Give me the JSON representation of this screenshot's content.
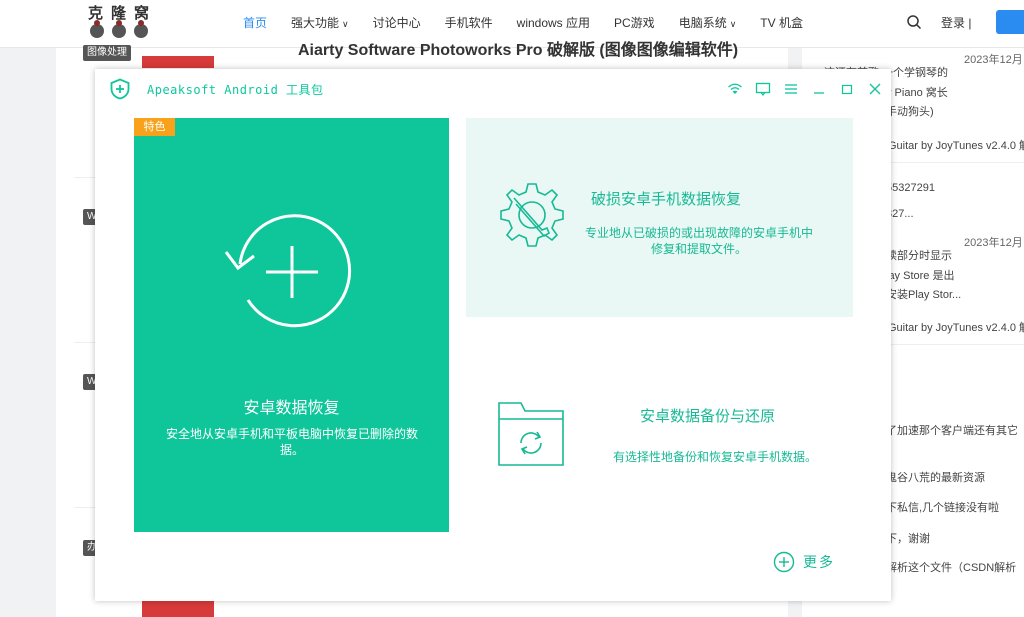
{
  "site": {
    "logo_text": "克隆窝",
    "nav": [
      {
        "label": "首页",
        "active": true,
        "dropdown": false
      },
      {
        "label": "强大功能",
        "active": false,
        "dropdown": true
      },
      {
        "label": "讨论中心",
        "active": false,
        "dropdown": false
      },
      {
        "label": "手机软件",
        "active": false,
        "dropdown": false
      },
      {
        "label": "windows 应用",
        "active": false,
        "dropdown": false
      },
      {
        "label": "PC游戏",
        "active": false,
        "dropdown": false
      },
      {
        "label": "电脑系统",
        "active": false,
        "dropdown": true
      },
      {
        "label": "TV 机盒",
        "active": false,
        "dropdown": false
      }
    ],
    "nav_dropdown_glyph": "∨",
    "login_label": "登录 |",
    "article_tag_1": "图像处理",
    "article_title_1": "Aiarty Software Photoworks Pro 破解版 (图像图像编辑软件)",
    "article_tag_2": "W",
    "article_tag_3": "W",
    "article_tag_4": "办",
    "sidebar": {
      "date_1": "2023年12月",
      "text_1": "这还有首歌 一个学钢琴的",
      "text_2": "y Piano 窝长",
      "text_3": "手动狗头)",
      "text_4": "Guitar by JoyTunes v2.4.0 解",
      "text_5": "55327291",
      "text_6": "327...",
      "date_2": "2023年12月",
      "text_7": "读部分时显示",
      "text_8": "lay Store 是出",
      "text_9": "安装Play Stor...",
      "text_10": "Guitar by JoyTunes v2.4.0 解",
      "text_11": "了加速那个客户端还有其它",
      "text_12": "鬼谷八荒的最新资源",
      "text_13": "下私信,几个链接没有啦",
      "text_14": "下，谢谢",
      "text_15": "解析这个文件（CSDN解析"
    }
  },
  "app": {
    "title": "Apeaksoft Android 工具包",
    "accent_color": "#0fc69b",
    "badge_color": "#f7a21a",
    "titlebar_icons": [
      "wifi-icon",
      "feedback-icon",
      "menu-icon",
      "minimize-icon",
      "maximize-icon",
      "close-icon"
    ],
    "panels": {
      "data_recovery": {
        "badge": "特色",
        "title": "安卓数据恢复",
        "desc": "安全地从安卓手机和平板电脑中恢复已删除的数据。"
      },
      "broken_recovery": {
        "title": "破损安卓手机数据恢复",
        "desc": "专业地从已破损的或出现故障的安卓手机中修复和提取文件。"
      },
      "backup_restore": {
        "title": "安卓数据备份与还原",
        "desc": "有选择性地备份和恢复安卓手机数据。"
      }
    },
    "more_label": "更多"
  }
}
